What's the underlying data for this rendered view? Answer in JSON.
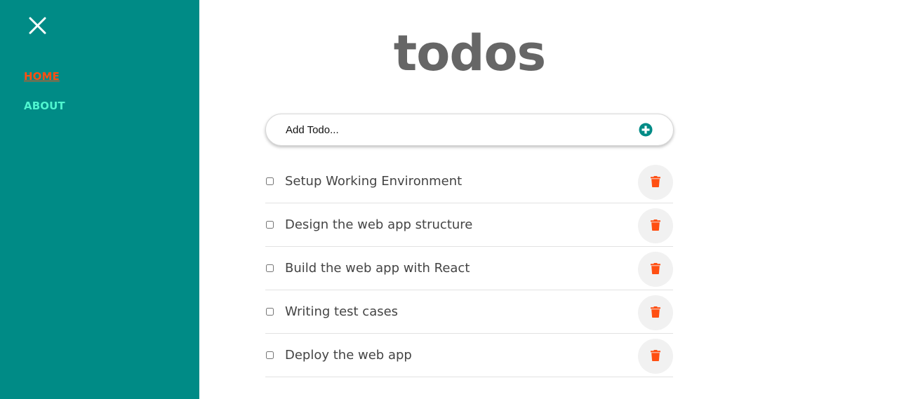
{
  "sidebar": {
    "close_icon": "close-icon",
    "nav": [
      {
        "label": "HOME",
        "active": true,
        "color": "#ff4f12"
      },
      {
        "label": "ABOUT",
        "active": false,
        "color": "#4ff5cf"
      }
    ],
    "background": "#008b86"
  },
  "main": {
    "title": "todos",
    "add_todo": {
      "placeholder": "Add Todo...",
      "button_icon": "plus-circle-icon",
      "accent": "#008b86"
    },
    "todos": [
      {
        "text": "Setup Working Environment",
        "checked": false
      },
      {
        "text": "Design the web app structure",
        "checked": false
      },
      {
        "text": "Build the web app with React",
        "checked": false
      },
      {
        "text": "Writing test cases",
        "checked": false
      },
      {
        "text": "Deploy the web app",
        "checked": false
      }
    ],
    "delete_icon": "trash-icon",
    "delete_color": "#ff4f12"
  }
}
